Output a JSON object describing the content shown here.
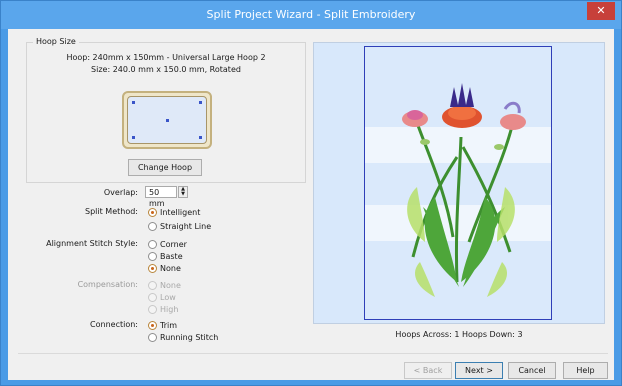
{
  "window": {
    "title": "Split Project Wizard - Split Embroidery",
    "close_glyph": "✕"
  },
  "hoop_size": {
    "legend": "Hoop Size",
    "line1": "Hoop: 240mm x 150mm - Universal Large Hoop 2",
    "line2": "Size: 240.0 mm x 150.0 mm, Rotated",
    "change_hoop_label": "Change Hoop"
  },
  "overlap": {
    "label": "Overlap:",
    "value": "50 mm"
  },
  "split_method": {
    "label": "Split Method:",
    "options": [
      "Intelligent",
      "Straight Line"
    ],
    "selected": "Intelligent"
  },
  "alignment": {
    "label": "Alignment Stitch Style:",
    "options": [
      "Corner",
      "Baste",
      "None"
    ],
    "selected": "None"
  },
  "compensation": {
    "label": "Compensation:",
    "options": [
      "None",
      "Low",
      "High"
    ],
    "selected": "None",
    "enabled": false
  },
  "connection": {
    "label": "Connection:",
    "options": [
      "Trim",
      "Running Stitch"
    ],
    "selected": "Trim"
  },
  "preview": {
    "hoops_summary": "Hoops Across: 1  Hoops Down: 3"
  },
  "footer": {
    "back": "< Back",
    "next": "Next >",
    "cancel": "Cancel",
    "help": "Help"
  },
  "colors": {
    "accent": "#c9661c",
    "titlebar": "#5aa6ec",
    "close": "#c7403a",
    "hoop_outline": "#2f3fb8"
  }
}
